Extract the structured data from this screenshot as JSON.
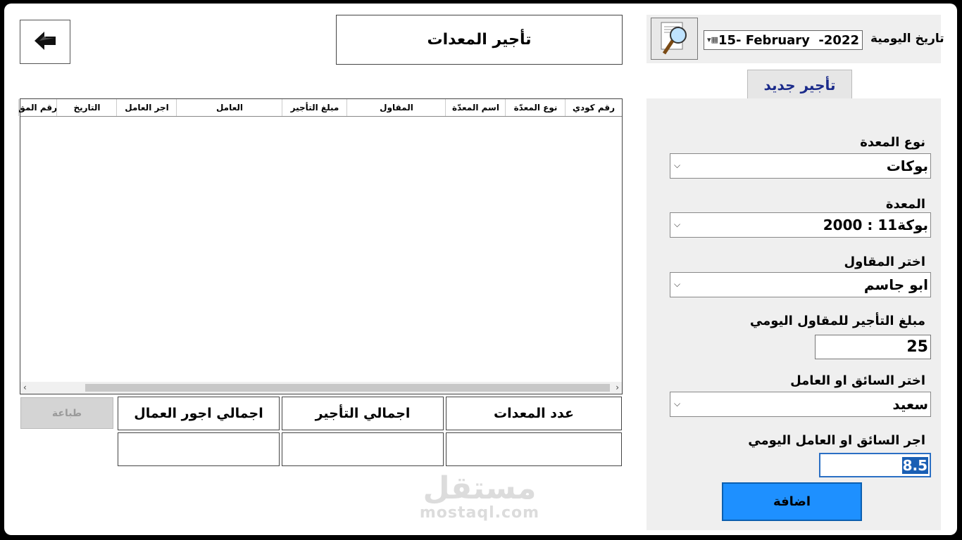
{
  "header": {
    "back_label": "",
    "title": "تأجير المعدات"
  },
  "date_section": {
    "label": "تاريخ اليومية",
    "date_value": "15- February  -2022"
  },
  "tabs": {
    "new_rental": "تأجير جديد"
  },
  "form": {
    "equipment_type_label": "نوع المعدة",
    "equipment_type_value": "بوكات",
    "equipment_label": "المعدة",
    "equipment_value": "بوكة11 : 2000",
    "contractor_label": "اختر المقاول",
    "contractor_value": "ابو جاسم",
    "rental_amount_label": "مبلغ التأجير للمقاول اليومي",
    "rental_amount_value": "25",
    "worker_label": "اختر السائق او العامل",
    "worker_value": "سعيد",
    "worker_wage_label": "اجر السائق او العامل اليومي",
    "worker_wage_value": "8.5",
    "add_button": "اضافة"
  },
  "grid": {
    "columns": [
      "رقم كودي",
      "نوع المعدّة",
      "اسم المعدّة",
      "المقاول",
      "مبلغ التأجير",
      "العامل",
      "اجر العامل",
      "التاريخ",
      "رقم المق"
    ],
    "rows": []
  },
  "summary": {
    "equipment_count_label": "عدد المعدات",
    "total_rental_label": "اجمالي التأجير",
    "total_wages_label": "اجمالي اجور العمال",
    "equipment_count_value": "",
    "total_rental_value": "",
    "total_wages_value": "",
    "print_button": "طباعة"
  },
  "watermark": {
    "arabic": "مستقل",
    "latin": "mostaql.com"
  },
  "colors": {
    "accent": "#1e90ff",
    "tab_text": "#1a2a8a",
    "panel_bg": "#efefef"
  }
}
